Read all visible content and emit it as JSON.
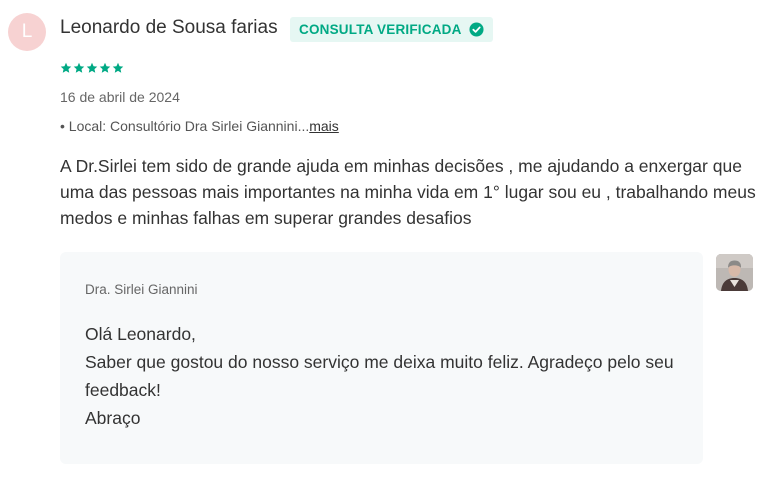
{
  "review": {
    "avatar_letter": "L",
    "reviewer_name": "Leonardo de Sousa farias",
    "verified_label": "CONSULTA VERIFICADA",
    "rating": 5,
    "date": "16 de abril de 2024",
    "location_prefix": "• Local: Consultório Dra Sirlei Giannini...",
    "location_more": "mais",
    "text": "A Dr.Sirlei tem sido de grande ajuda em minhas decisões , me ajudando a enxergar que uma das pessoas mais importantes na minha vida em 1° lugar sou eu , trabalhando meus medos e minhas falhas em superar grandes desafios"
  },
  "reply": {
    "author": "Dra. Sirlei Giannini",
    "lines": [
      "Olá Leonardo,",
      "Saber que gostou do nosso serviço me deixa muito feliz. Agradeço pelo seu feedback!",
      "Abraço"
    ]
  },
  "colors": {
    "accent_green": "#00a984",
    "badge_bg": "#e6f7f3",
    "avatar_bg": "#f7d2d2",
    "reply_bg": "#f7f9fa"
  },
  "icons": {
    "verified": "check-circle-icon",
    "rating": "star-icon"
  }
}
